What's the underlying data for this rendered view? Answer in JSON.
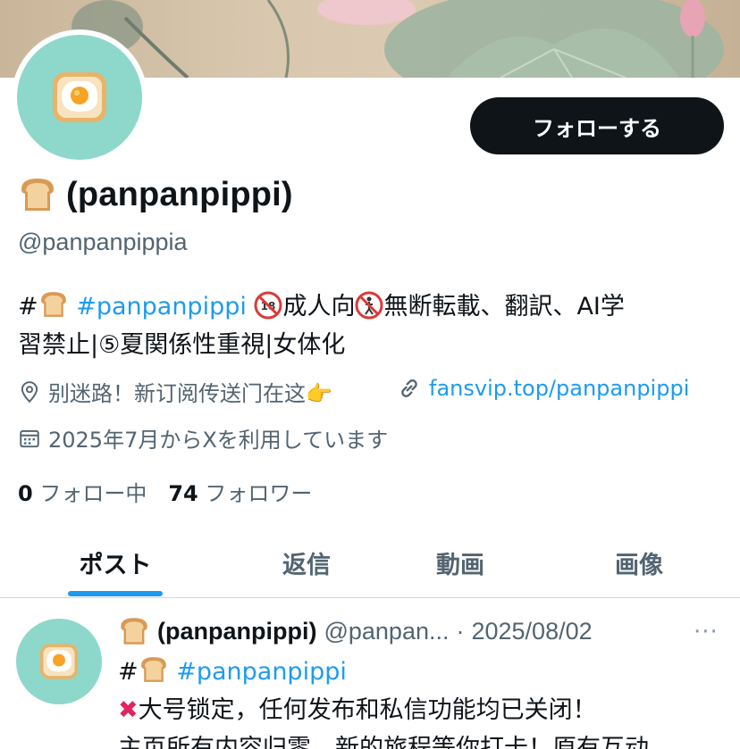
{
  "banner": {
    "description_icon": "lotus-painting"
  },
  "avatar": {
    "icon": "egg-toast-icon"
  },
  "follow_button": {
    "label": "フォローする"
  },
  "profile": {
    "name": "(panpanpippi)",
    "name_icon": "bread-icon",
    "handle": "@panpanpippia"
  },
  "bio": {
    "hash": "#",
    "hashtag": "#panpanpippi",
    "part1": "成人向",
    "part2": "無断転載、翻訳、AI学",
    "line2": "習禁止|⑤夏関係性重視|女体化"
  },
  "meta": {
    "location": "别迷路！新订阅传送门在这👉",
    "link": "fansvip.top/panpanpippi",
    "joined": "2025年7月からXを利用しています"
  },
  "counts": {
    "following_num": "0",
    "following_label": "フォロー中",
    "followers_num": "74",
    "followers_label": "フォロワー"
  },
  "tabs": [
    {
      "label": "ポスト"
    },
    {
      "label": "返信"
    },
    {
      "label": "動画"
    },
    {
      "label": "画像"
    }
  ],
  "post": {
    "name": "(panpanpippi)",
    "handle": "@panpan...",
    "separator": "·",
    "date": "2025/08/02",
    "more": "···",
    "hash": "#",
    "hashtag": "#panpanpippi",
    "line2": "大号锁定，任何发布和私信功能均已关闭！",
    "line3": "主页所有内容归零，新的旅程等你打卡！原有互动"
  },
  "colors": {
    "accent": "#1d9bf0",
    "text": "#0f1419",
    "muted": "#536471",
    "avatar_bg": "#8dd8cb"
  }
}
